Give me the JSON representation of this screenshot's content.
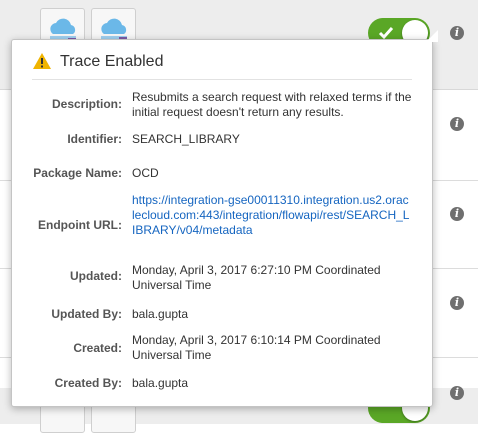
{
  "popover": {
    "title": "Trace Enabled",
    "fields": [
      {
        "label": "Description:",
        "value": "Resubmits a search request with relaxed terms if the initial request doesn't return any results."
      },
      {
        "label": "Identifier:",
        "value": "SEARCH_LIBRARY"
      },
      {
        "label": "Package Name:",
        "value": "OCD"
      },
      {
        "label": "Endpoint URL:",
        "value": "https://integration-gse00011310.integration.us2.oraclecloud.com:443/integration/flowapi/rest/SEARCH_LIBRARY/v04/metadata"
      },
      {
        "label": "Updated:",
        "value": "Monday, April 3, 2017 6:27:10 PM Coordinated Universal Time"
      },
      {
        "label": "Updated By:",
        "value": "bala.gupta"
      },
      {
        "label": "Created:",
        "value": "Monday, April 3, 2017 6:10:14 PM Coordinated Universal Time"
      },
      {
        "label": "Created By:",
        "value": "bala.gupta"
      }
    ]
  },
  "icons": {
    "warning": "warning-icon",
    "info": "info-icon",
    "trigger": "cloud-trigger-icon",
    "invoke": "cloud-invoke-icon",
    "check": "check-icon"
  },
  "toggle": {
    "state": "on"
  },
  "colors": {
    "toggle_on": "#5aa726",
    "link": "#1565c0",
    "warning": "#f0b400",
    "cloud": "#6bb8e8",
    "adapter": "#7b5aa6"
  }
}
